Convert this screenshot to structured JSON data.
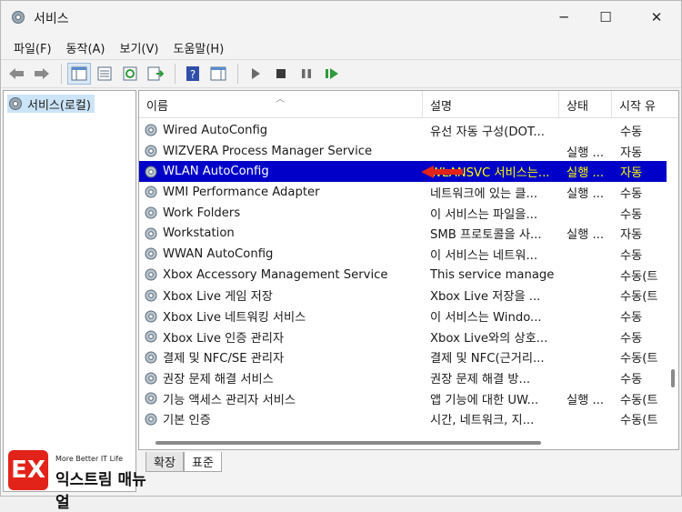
{
  "window": {
    "title": "서비스",
    "minimize": "─",
    "maximize": "☐",
    "close": "✕"
  },
  "menu": [
    "파일(F)",
    "동작(A)",
    "보기(V)",
    "도움말(H)"
  ],
  "tree": {
    "label": "서비스(로컬)"
  },
  "columns": {
    "name": "이름",
    "desc": "설명",
    "status": "상태",
    "start": "시작 유"
  },
  "rows": [
    {
      "name": "Wired AutoConfig",
      "desc": "유선 자동 구성(DOT...",
      "status": "",
      "start": "수동"
    },
    {
      "name": "WIZVERA Process Manager Service",
      "desc": "",
      "status": "실행 ...",
      "start": "자동"
    },
    {
      "name": "WLAN AutoConfig",
      "desc": "WLANSVC 서비스는...",
      "status": "실행 ...",
      "start": "자동"
    },
    {
      "name": "WMI Performance Adapter",
      "desc": "네트워크에 있는 클...",
      "status": "실행 ...",
      "start": "수동"
    },
    {
      "name": "Work Folders",
      "desc": "이 서비스는 파일을...",
      "status": "",
      "start": "수동"
    },
    {
      "name": "Workstation",
      "desc": "SMB 프로토콜을 사...",
      "status": "실행 ...",
      "start": "자동"
    },
    {
      "name": "WWAN AutoConfig",
      "desc": "이 서비스는 네트워...",
      "status": "",
      "start": "수동"
    },
    {
      "name": "Xbox Accessory Management Service",
      "desc": "This service manage...",
      "status": "",
      "start": "수동(트"
    },
    {
      "name": "Xbox Live 게임 저장",
      "desc": "Xbox Live 저장을 ...",
      "status": "",
      "start": "수동(트"
    },
    {
      "name": "Xbox Live 네트워킹 서비스",
      "desc": "이 서비스는 Windo...",
      "status": "",
      "start": "수동"
    },
    {
      "name": "Xbox Live 인증 관리자",
      "desc": "Xbox Live와의 상호...",
      "status": "",
      "start": "수동"
    },
    {
      "name": "결제 및 NFC/SE 관리자",
      "desc": "결제 및 NFC(근거리...",
      "status": "",
      "start": "수동(트"
    },
    {
      "name": "권장 문제 해결 서비스",
      "desc": "권장 문제 해결 방...",
      "status": "",
      "start": "수동"
    },
    {
      "name": "기능 액세스 관리자 서비스",
      "desc": "앱 기능에 대한 UW...",
      "status": "실행 ...",
      "start": "수동(트"
    },
    {
      "name": "기본 인증",
      "desc": "시간, 네트워크, 지...",
      "status": "",
      "start": "수동(트"
    }
  ],
  "selected_row": "WLAN AutoConfig",
  "tabs": {
    "extended": "확장",
    "standard": "표준"
  },
  "watermark": {
    "mark": "EX",
    "tagline": "More Better IT Life",
    "name": "익스트림 매뉴얼"
  },
  "colors": {
    "selection": "#0000c8",
    "selection_text": "#ffff00",
    "arrow": "#e2231a"
  }
}
